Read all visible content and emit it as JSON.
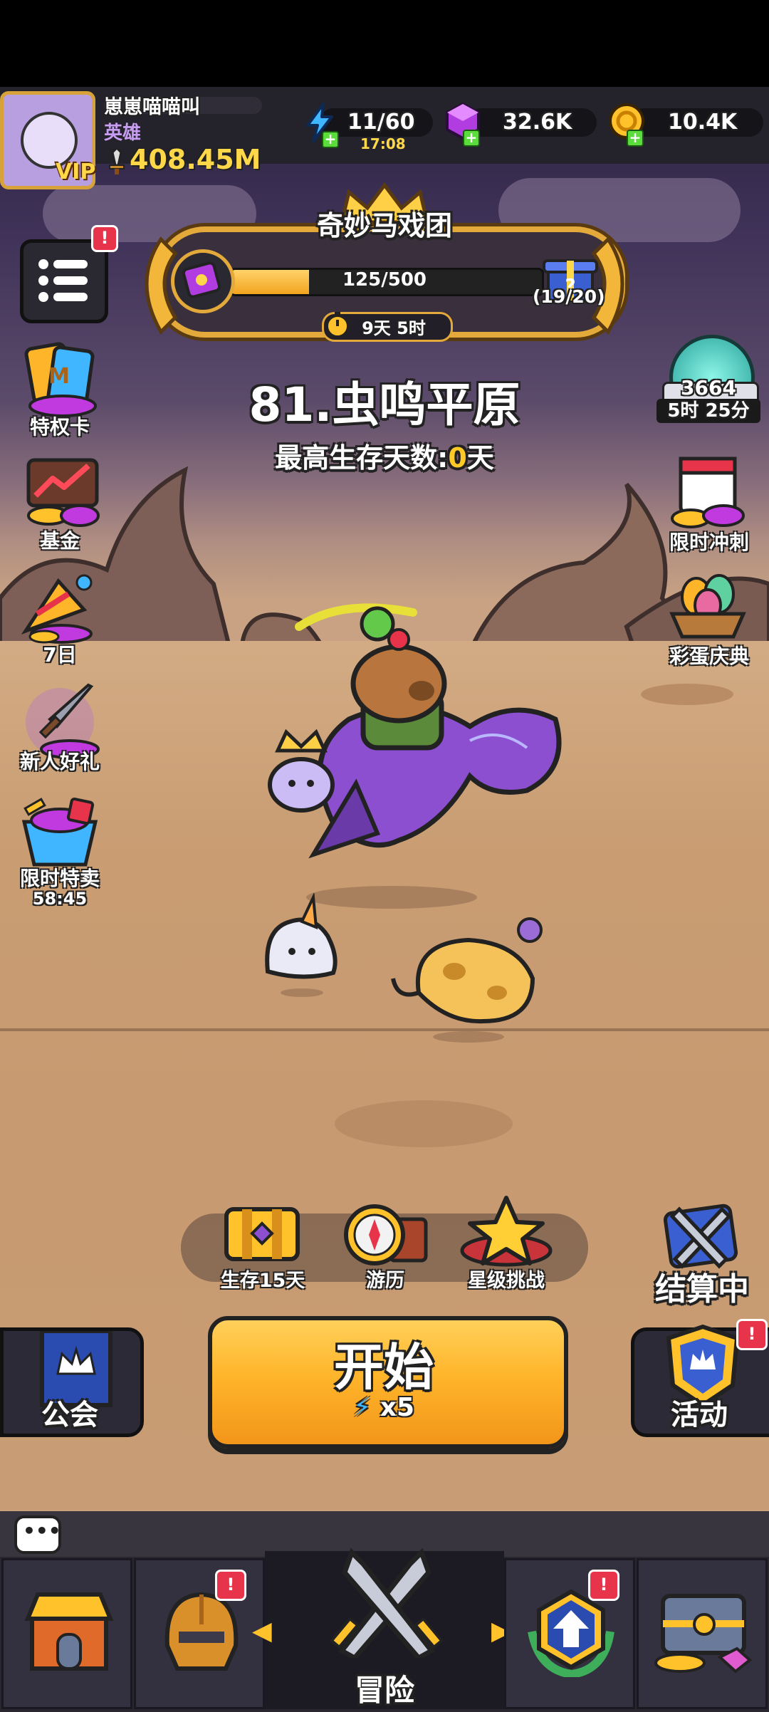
{
  "player": {
    "name": "崽崽喵喵叫",
    "title": "英雄",
    "vip_label": "VIP",
    "power": "408.45M"
  },
  "resources": {
    "energy": "11/60",
    "energy_timer": "17:08",
    "gems": "32.6K",
    "coins": "10.4K"
  },
  "event_banner": {
    "title": "奇妙马戏团",
    "progress_text": "125/500",
    "progress_fraction": 0.25,
    "reward_count": "(19/20)",
    "timer": "9天 5时"
  },
  "stage": {
    "name": "81.虫鸣平原",
    "best_label": "最高生存天数:",
    "best_value": "0",
    "best_unit": "天"
  },
  "left_sidebar": [
    {
      "label": "特权卡",
      "icon": "privilege-card-icon"
    },
    {
      "label": "基金",
      "icon": "fund-chart-icon"
    },
    {
      "label": "7日",
      "icon": "party-popper-icon"
    },
    {
      "label": "新人好礼",
      "icon": "sword-gift-icon"
    },
    {
      "label": "限时特卖",
      "icon": "sale-basket-icon",
      "timer": "58:45"
    }
  ],
  "right_sidebar": {
    "orb_value": "3664",
    "orb_timer": "5时 25分",
    "items": [
      {
        "label": "限时冲刺",
        "icon": "calendar-gems-icon"
      },
      {
        "label": "彩蛋庆典",
        "icon": "egg-basket-icon"
      }
    ]
  },
  "tray": [
    {
      "label": "生存15天",
      "icon": "treasure-chest-icon"
    },
    {
      "label": "游历",
      "icon": "compass-icon"
    },
    {
      "label": "星级挑战",
      "icon": "star-challenge-icon"
    }
  ],
  "settlement_label": "结算中",
  "start_button": {
    "label": "开始",
    "cost": "x5"
  },
  "guild_label": "公会",
  "event_label": "活动",
  "badge": "!",
  "nav": {
    "center_label": "冒险",
    "items": [
      "shop-icon",
      "helmet-icon",
      "crossed-swords-icon",
      "upgrade-arrow-icon",
      "treasure-chest-icon"
    ]
  },
  "colors": {
    "accent_orange": "#ffb52a",
    "gold": "#e3a93a",
    "badge_red": "#e8344a",
    "highlight_yellow": "#ffc928"
  }
}
